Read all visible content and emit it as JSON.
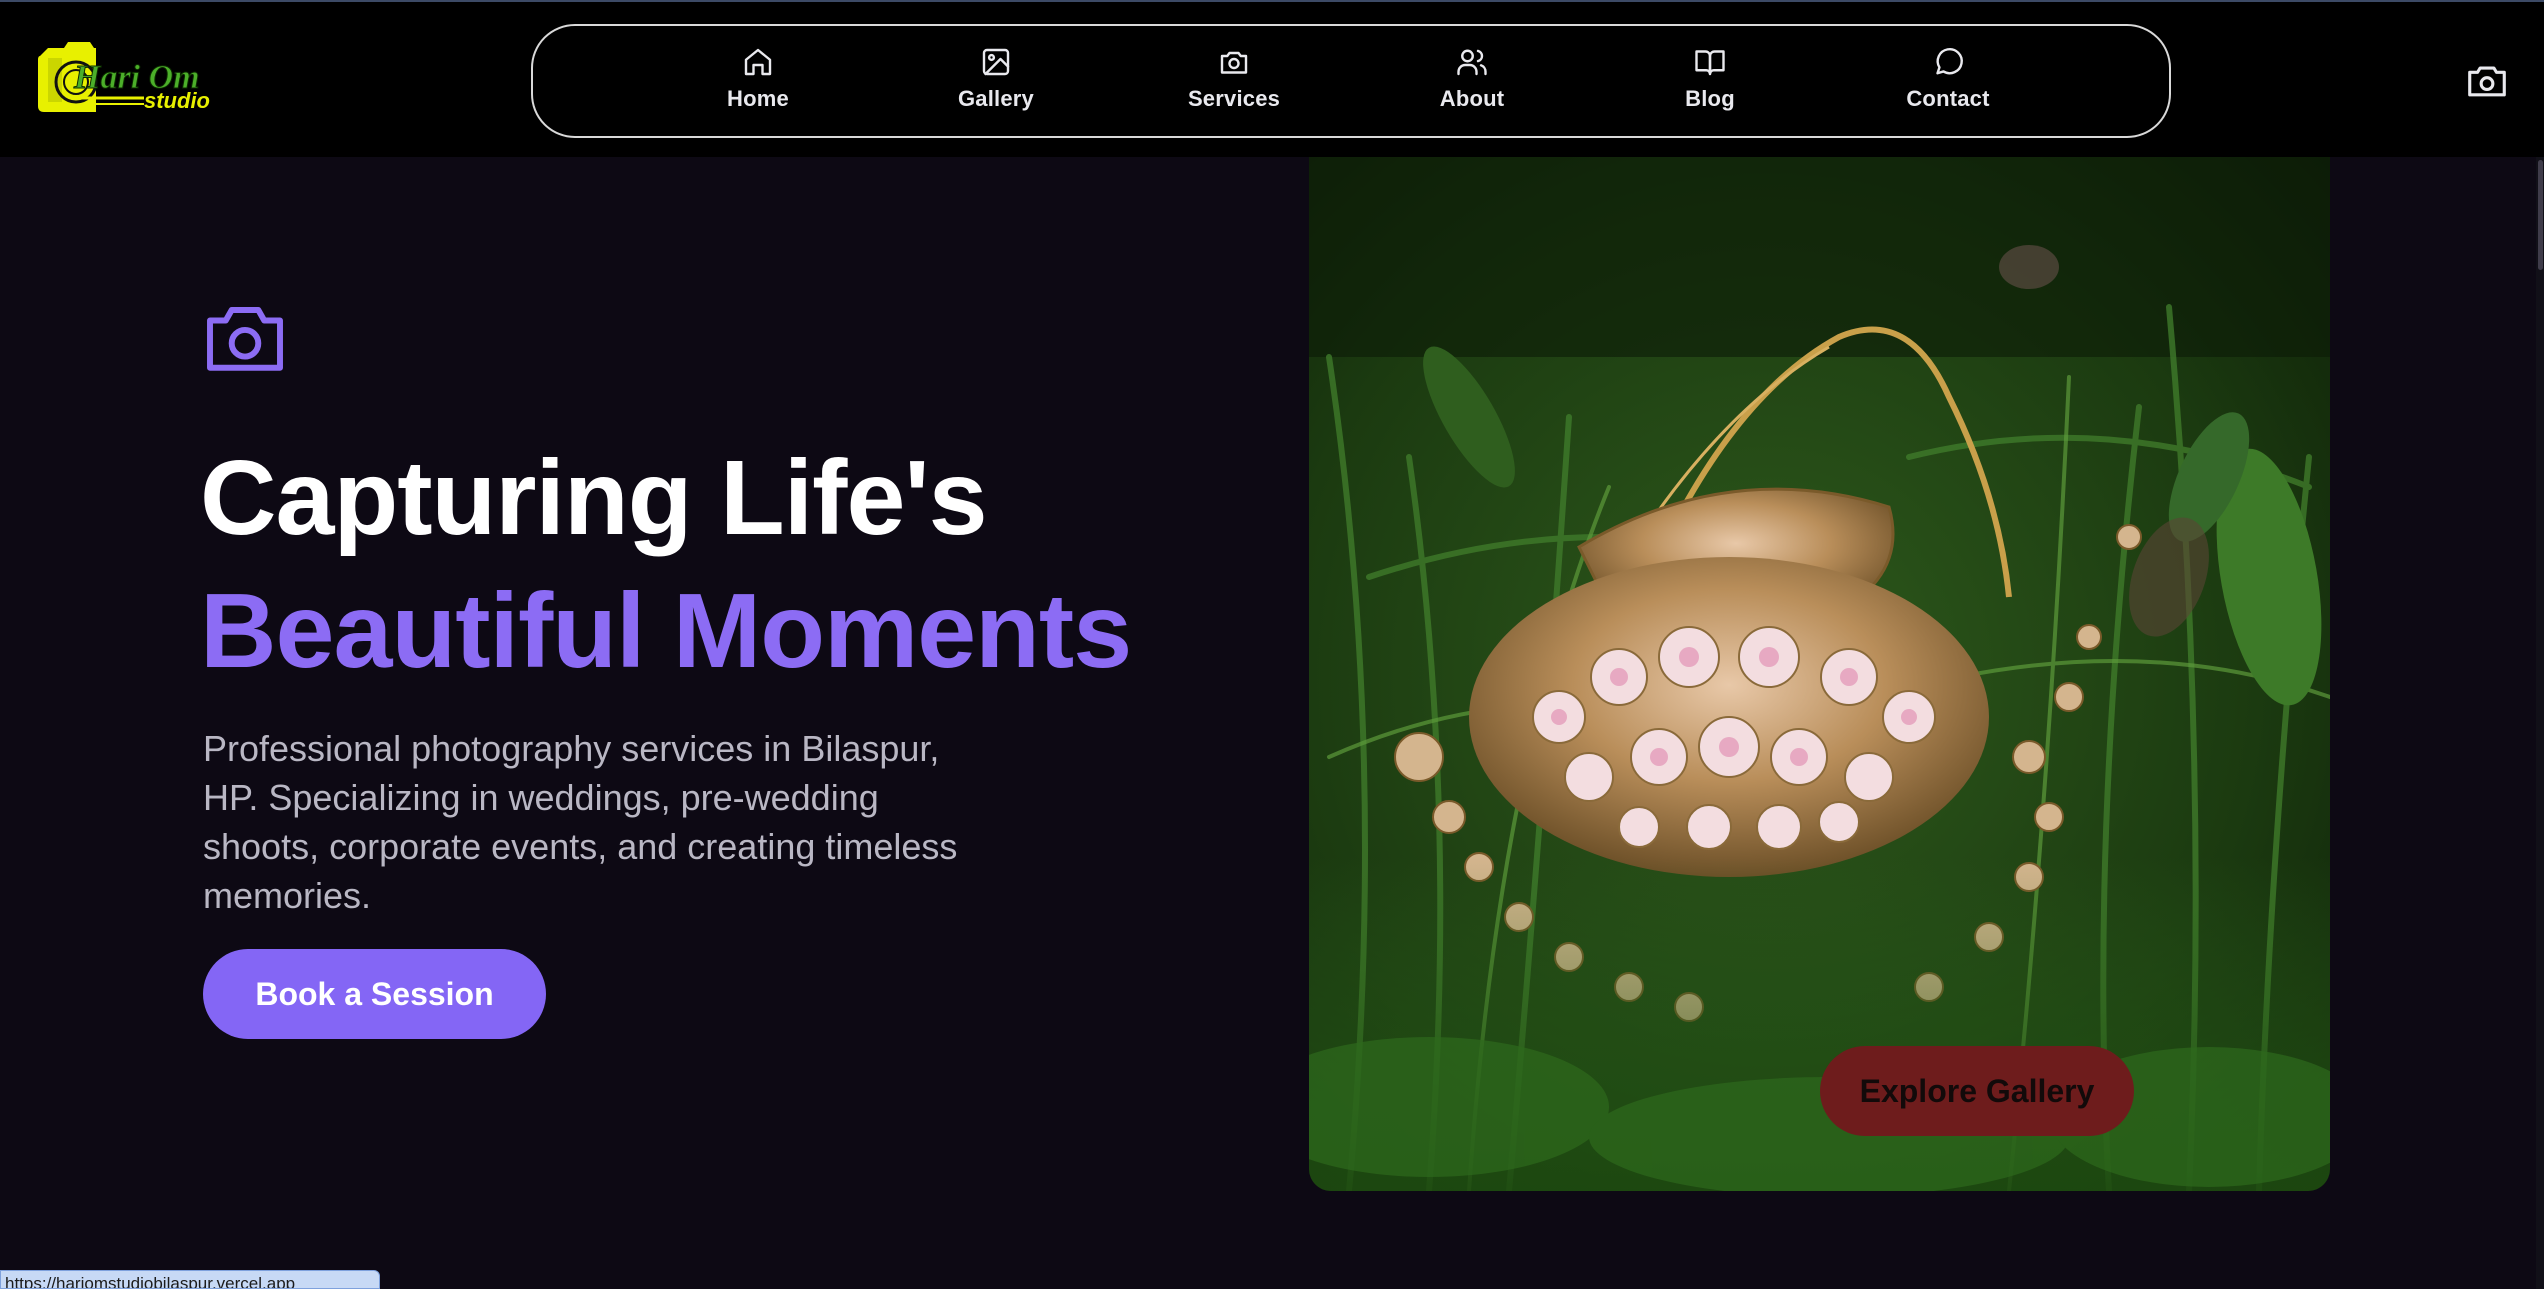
{
  "brand": {
    "logo_text_line1": "Hari Om",
    "logo_text_line2": "Studio",
    "accent_color": "#8c6cf4",
    "logo_color": "#e8f000"
  },
  "nav": {
    "items": [
      {
        "label": "Home",
        "icon": "home-icon"
      },
      {
        "label": "Gallery",
        "icon": "image-icon"
      },
      {
        "label": "Services",
        "icon": "camera-icon"
      },
      {
        "label": "About",
        "icon": "users-icon"
      },
      {
        "label": "Blog",
        "icon": "book-open-icon"
      },
      {
        "label": "Contact",
        "icon": "message-circle-icon"
      }
    ],
    "right_icon": "camera-icon"
  },
  "hero": {
    "icon": "camera-icon",
    "headline_line1": "Capturing Life's",
    "headline_line2": "Beautiful Moments",
    "description": "Professional photography services in Bilaspur, HP. Specializing in weddings, pre-wedding shoots, corporate events, and creating timeless memories.",
    "cta_primary": "Book a Session",
    "cta_secondary": "Explore Gallery",
    "image_subject": "bridal-jewelry-necklace-in-grass"
  },
  "status_bar": {
    "url": "https://hariomstudiobilaspur.vercel.app"
  }
}
